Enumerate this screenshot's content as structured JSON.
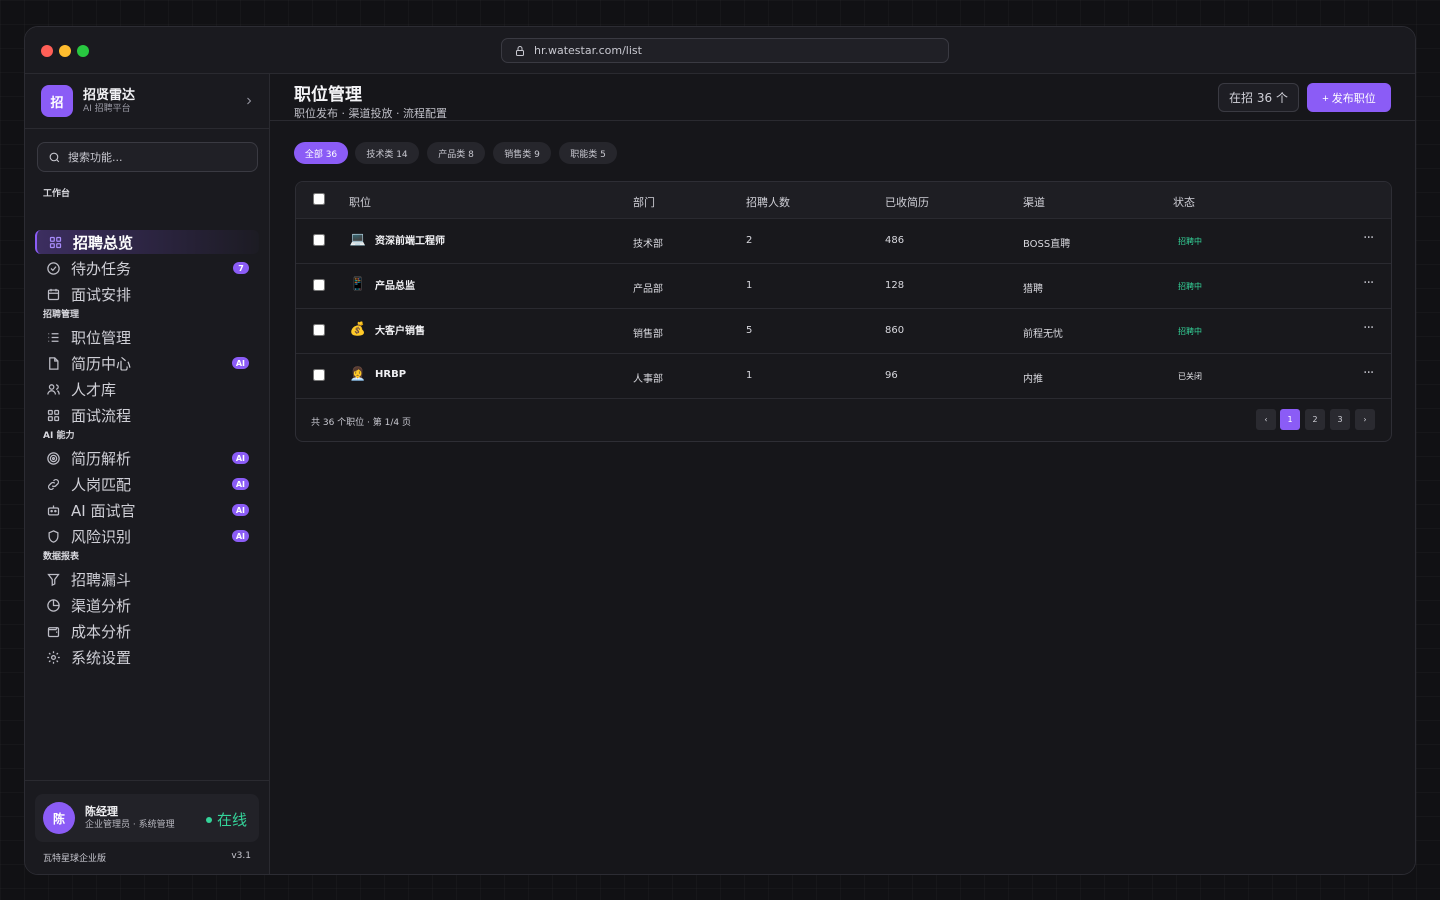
{
  "browser": {
    "url": "hr.watestar.com/list"
  },
  "brand": {
    "logo_char": "招",
    "name": "招贤雷达",
    "subtitle": "AI 招聘平台"
  },
  "search": {
    "placeholder": "搜索功能..."
  },
  "sidebar": {
    "sections": [
      {
        "label": "工作台"
      },
      {
        "label": "招聘管理"
      },
      {
        "label": "AI 能力"
      },
      {
        "label": "数据报表"
      }
    ],
    "items": [
      {
        "label": "招聘总览",
        "icon": "grid-icon",
        "active": true
      },
      {
        "label": "待办任务",
        "icon": "check-circle-icon",
        "badge": "7"
      },
      {
        "label": "面试安排",
        "icon": "calendar-icon"
      },
      {
        "label": "职位管理",
        "icon": "list-icon"
      },
      {
        "label": "简历中心",
        "icon": "file-icon",
        "badge": "AI"
      },
      {
        "label": "人才库",
        "icon": "users-icon"
      },
      {
        "label": "面试流程",
        "icon": "grid-icon"
      },
      {
        "label": "简历解析",
        "icon": "target-icon",
        "badge": "AI"
      },
      {
        "label": "人岗匹配",
        "icon": "link-icon",
        "badge": "AI"
      },
      {
        "label": "AI 面试官",
        "icon": "bot-icon",
        "badge": "AI"
      },
      {
        "label": "风险识别",
        "icon": "shield-icon",
        "badge": "AI"
      },
      {
        "label": "招聘漏斗",
        "icon": "filter-icon"
      },
      {
        "label": "渠道分析",
        "icon": "pie-icon"
      },
      {
        "label": "成本分析",
        "icon": "wallet-icon"
      },
      {
        "label": "系统设置",
        "icon": "gear-icon"
      }
    ]
  },
  "user": {
    "avatar_char": "陈",
    "name": "陈经理",
    "role": "企业管理员 · 系统管理",
    "status": "在线",
    "edition": "瓦特星球企业版",
    "version": "v3.1"
  },
  "header": {
    "title": "职位管理",
    "subtitle": "职位发布 · 渠道投放 · 流程配置",
    "count_label": "在招 36 个",
    "publish_label": "+ 发布职位"
  },
  "filters": [
    {
      "label": "全部 36",
      "active": true
    },
    {
      "label": "技术类 14"
    },
    {
      "label": "产品类 8"
    },
    {
      "label": "销售类 9"
    },
    {
      "label": "职能类 5"
    }
  ],
  "table": {
    "columns": [
      "职位",
      "部门",
      "招聘人数",
      "已收简历",
      "渠道",
      "状态"
    ],
    "rows": [
      {
        "emoji": "💻",
        "title": "资深前端工程师",
        "dept": "技术部",
        "headcount": "2",
        "resumes": "486",
        "channel": "BOSS直聘",
        "status": "招聘中",
        "status_type": "open"
      },
      {
        "emoji": "📱",
        "title": "产品总监",
        "dept": "产品部",
        "headcount": "1",
        "resumes": "128",
        "channel": "猎聘",
        "status": "招聘中",
        "status_type": "open"
      },
      {
        "emoji": "💰",
        "title": "大客户销售",
        "dept": "销售部",
        "headcount": "5",
        "resumes": "860",
        "channel": "前程无忧",
        "status": "招聘中",
        "status_type": "open"
      },
      {
        "emoji": "👩‍💼",
        "title": "HRBP",
        "dept": "人事部",
        "headcount": "1",
        "resumes": "96",
        "channel": "内推",
        "status": "已关闭",
        "status_type": "closed"
      }
    ],
    "more_label": "···",
    "footer": "共 36 个职位 · 第 1/4 页"
  },
  "pagination": {
    "prev": "‹",
    "pages": [
      "1",
      "2",
      "3"
    ],
    "current": "1",
    "next": "›"
  },
  "colors": {
    "accent": "#8b5cf6",
    "success": "#34d399",
    "bg": "#16161a"
  }
}
